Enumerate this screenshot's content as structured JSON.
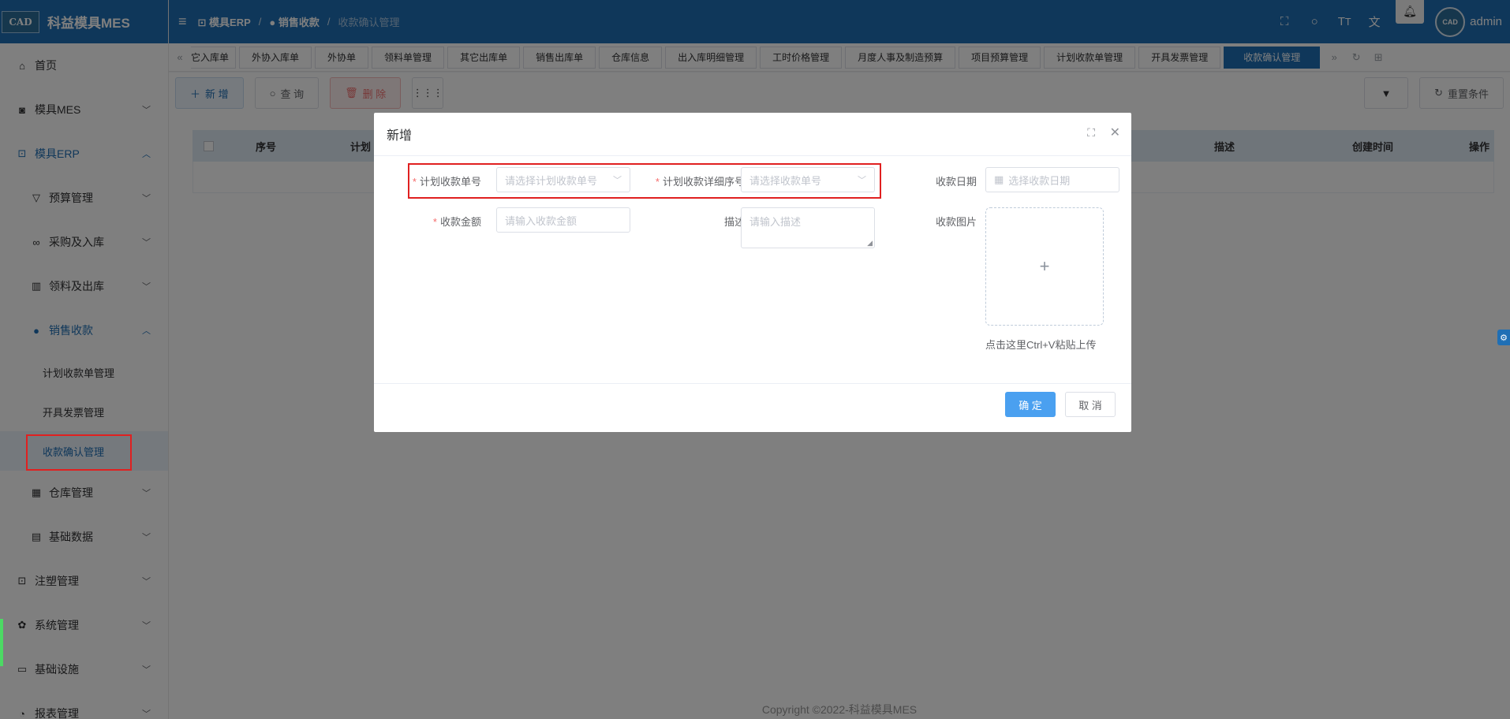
{
  "app": {
    "title": "科益模具MES",
    "logo": "CAD"
  },
  "header": {
    "breadcrumb": [
      "模具ERP",
      "销售收款",
      "收款确认管理"
    ],
    "username": "admin",
    "avatar": "CAD"
  },
  "sidebar": {
    "items": [
      {
        "label": "首页",
        "icon": "home-icon"
      },
      {
        "label": "模具MES",
        "icon": "camera-icon"
      },
      {
        "label": "模具ERP",
        "icon": "briefcase-icon"
      },
      {
        "label": "预算管理",
        "icon": "filter-icon"
      },
      {
        "label": "采购及入库",
        "icon": "cart-icon"
      },
      {
        "label": "领料及出库",
        "icon": "building-icon"
      },
      {
        "label": "销售收款",
        "icon": "user-icon"
      },
      {
        "label": "计划收款单管理"
      },
      {
        "label": "开具发票管理"
      },
      {
        "label": "收款确认管理"
      },
      {
        "label": "仓库管理",
        "icon": "calendar-icon"
      },
      {
        "label": "基础数据",
        "icon": "card-icon"
      },
      {
        "label": "注塑管理",
        "icon": "briefcase-icon"
      },
      {
        "label": "系统管理",
        "icon": "gear-icon"
      },
      {
        "label": "基础设施",
        "icon": "monitor-icon"
      },
      {
        "label": "报表管理",
        "icon": "pie-icon"
      }
    ]
  },
  "tabs": [
    "它入库单",
    "外协入库单",
    "外协单",
    "领料单管理",
    "其它出库单",
    "销售出库单",
    "仓库信息",
    "出入库明细管理",
    "工时价格管理",
    "月度人事及制造预算",
    "项目预算管理",
    "计划收款单管理",
    "开具发票管理",
    "收款确认管理"
  ],
  "toolbar": {
    "add": "新 增",
    "query": "查 询",
    "delete": "删 除",
    "reset": "重置条件"
  },
  "table": {
    "columns": [
      "序号",
      "计划",
      "描述",
      "创建时间",
      "操作"
    ]
  },
  "dialog": {
    "title": "新增",
    "fields": {
      "plan_no_label": "计划收款单号",
      "plan_no_placeholder": "请选择计划收款单号",
      "detail_no_label": "计划收款详细序号",
      "detail_no_placeholder": "请选择收款单号",
      "date_label": "收款日期",
      "date_placeholder": "选择收款日期",
      "amount_label": "收款金额",
      "amount_placeholder": "请输入收款金额",
      "desc_label": "描述",
      "desc_placeholder": "请输入描述",
      "image_label": "收款图片",
      "upload_hint": "点击这里Ctrl+V粘贴上传"
    },
    "ok": "确 定",
    "cancel": "取 消"
  },
  "footer": {
    "copyright": "Copyright ©2022-科益模具MES"
  },
  "colors": {
    "primary": "#1f6fb5",
    "annotation": "#e02020"
  }
}
